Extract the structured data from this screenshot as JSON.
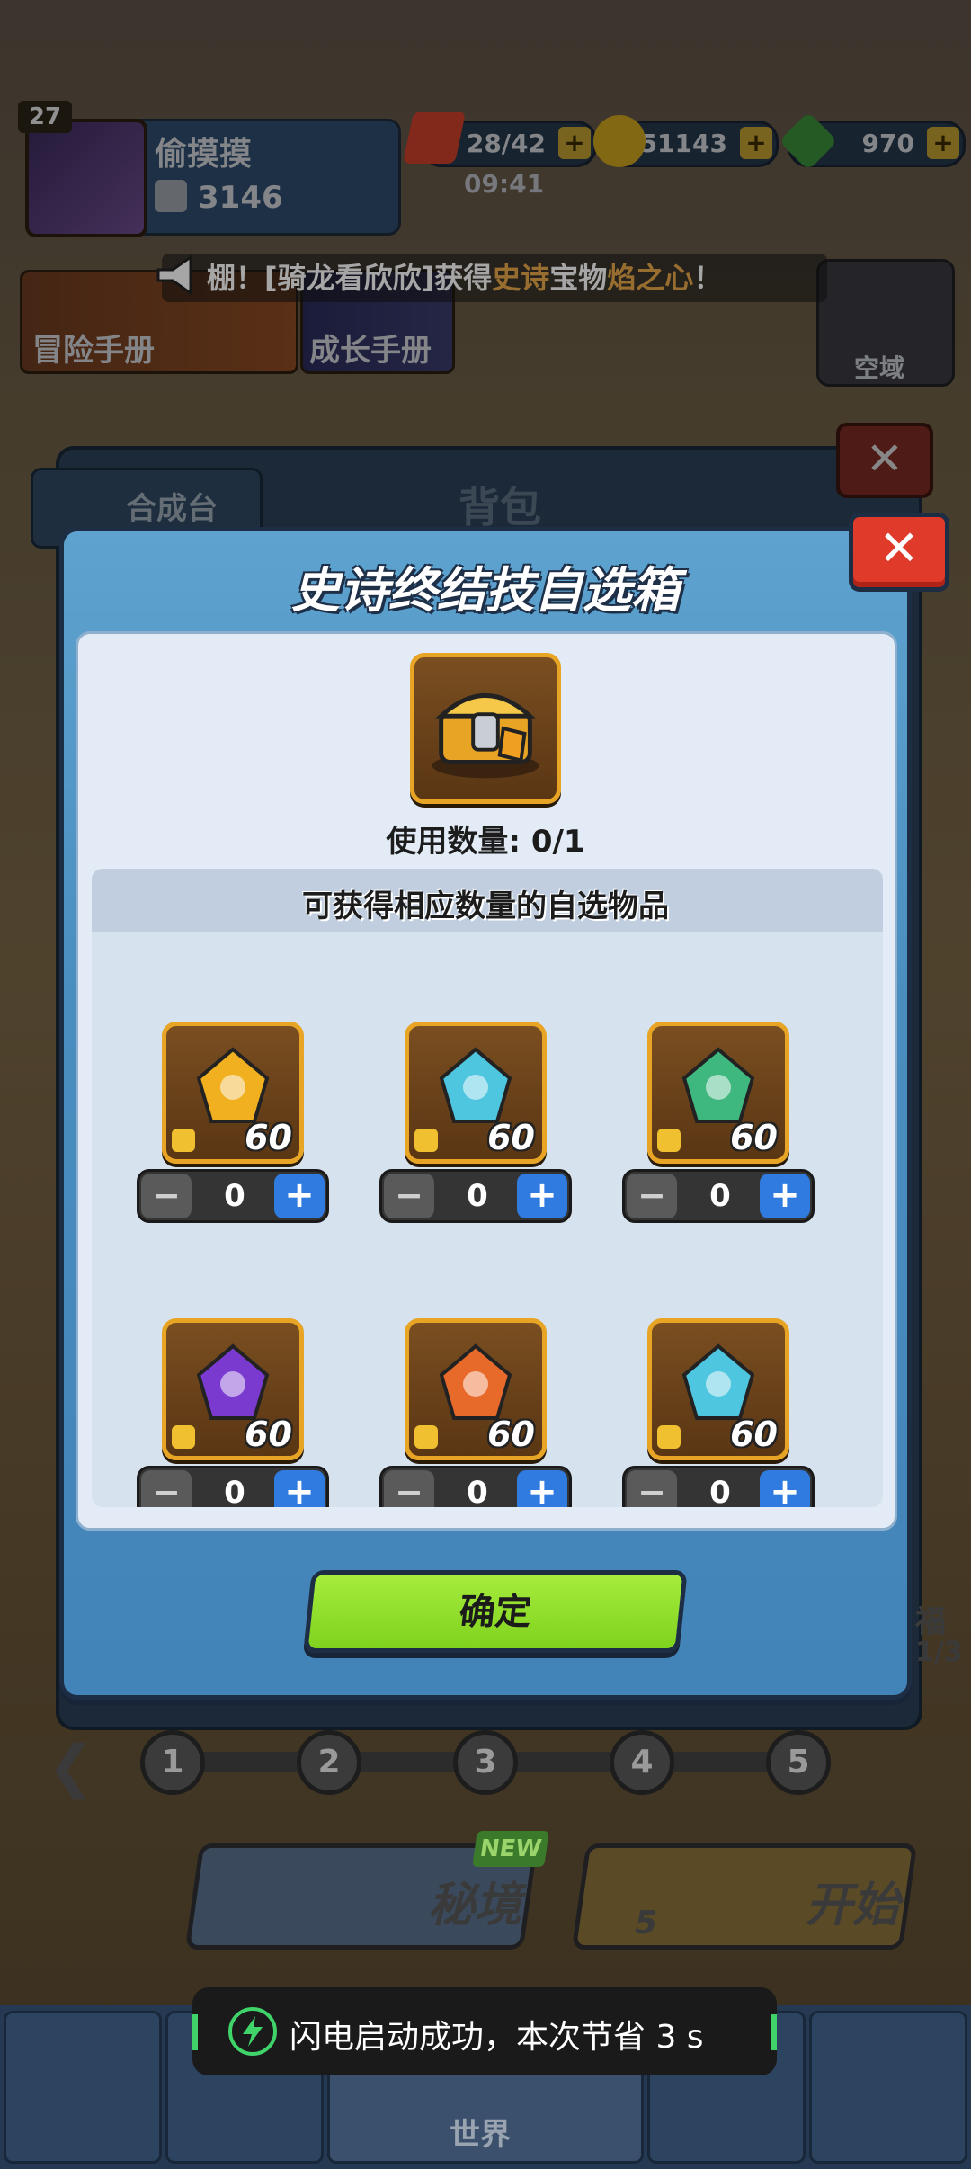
{
  "player": {
    "level": "27",
    "name": "偷摸摸",
    "power": "3146"
  },
  "resources": {
    "energy": "28/42",
    "energy_timer": "09:41",
    "gold": "51143",
    "gems": "970"
  },
  "broadcast": {
    "prefix": "棚！[骑龙看欣欣]获得",
    "rarity": "史诗",
    "mid": "宝物",
    "item": "焰之心",
    "suffix": "！"
  },
  "top_tiles": {
    "adventure": "冒险手册",
    "growth": "成长手册",
    "airspace": "空域"
  },
  "back_panel": {
    "tab_synth": "合成台",
    "title": "背包",
    "close": "✕"
  },
  "modal": {
    "title": "史诗终结技自选箱",
    "close": "✕",
    "use_count": "使用数量: 0/1",
    "subtitle": "可获得相应数量的自选物品",
    "items": [
      {
        "name": "golden-bat-relic-icon",
        "qty": "60",
        "count": "0",
        "color": "#f0b020"
      },
      {
        "name": "ice-triangle-relic-icon",
        "qty": "60",
        "count": "0",
        "color": "#4fc6e0"
      },
      {
        "name": "jade-lamp-relic-icon",
        "qty": "60",
        "count": "0",
        "color": "#3fb880"
      },
      {
        "name": "purple-orb-relic-icon",
        "qty": "60",
        "count": "0",
        "color": "#7a3ad0"
      },
      {
        "name": "fire-pot-relic-icon",
        "qty": "60",
        "count": "0",
        "color": "#e86a2a"
      },
      {
        "name": "ice-heart-relic-icon",
        "qty": "60",
        "count": "0",
        "color": "#4fc6e0"
      }
    ],
    "minus": "−",
    "plus": "+",
    "confirm": "确定"
  },
  "stages": [
    "1",
    "2",
    "3",
    "4",
    "5"
  ],
  "actions": {
    "secret_realm": "秘境",
    "new_badge": "NEW",
    "start": "开始",
    "energy_cost": "5"
  },
  "side": {
    "label": "福",
    "fraction": "1/3"
  },
  "nav": {
    "world": "世界"
  },
  "toast": {
    "text": "闪电启动成功，本次节省 3 s"
  }
}
